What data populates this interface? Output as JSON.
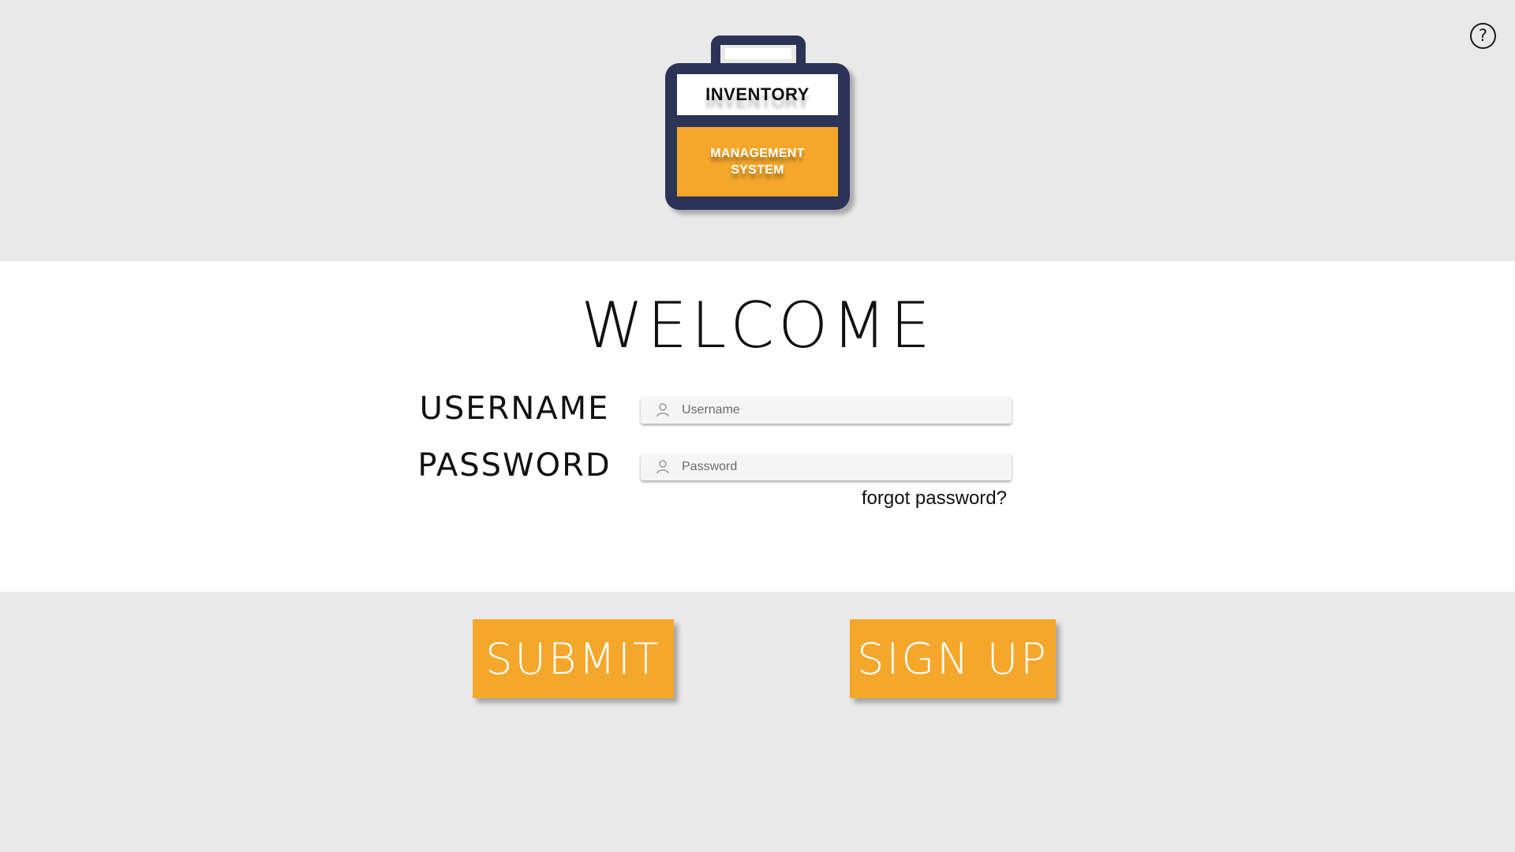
{
  "header": {
    "help_icon_glyph": "?",
    "logo": {
      "top_text": "INVENTORY",
      "bottom_line1": "MANAGEMENT",
      "bottom_line2": "SYSTEM",
      "case_color": "#2b3457",
      "accent_color": "#f5a72b"
    }
  },
  "login": {
    "title": "WELCOME",
    "username_label": "USERNAME",
    "username_placeholder": "Username",
    "password_label": "PASSWORD",
    "password_placeholder": "Password",
    "forgot_link": "forgot password?"
  },
  "actions": {
    "submit_label": "SUBMIT",
    "signup_label": "SIGN UP",
    "button_color": "#f5a72b"
  },
  "icons": {
    "help": "question-circle-icon",
    "input_user": "user-icon"
  }
}
